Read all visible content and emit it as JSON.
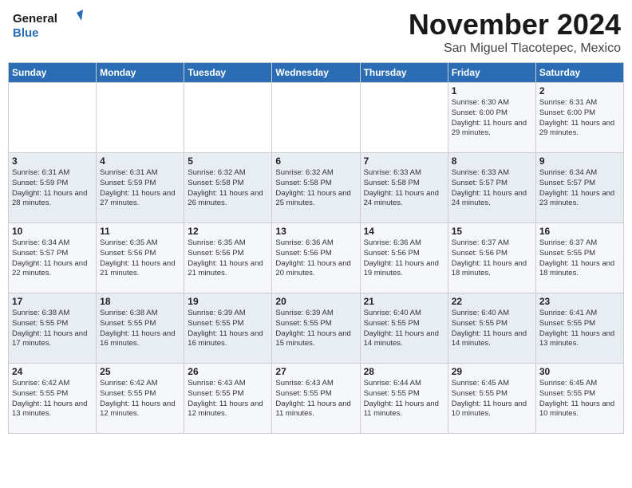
{
  "logo": {
    "line1": "General",
    "line2": "Blue"
  },
  "title": "November 2024",
  "subtitle": "San Miguel Tlacotepec, Mexico",
  "weekdays": [
    "Sunday",
    "Monday",
    "Tuesday",
    "Wednesday",
    "Thursday",
    "Friday",
    "Saturday"
  ],
  "weeks": [
    [
      {
        "day": "",
        "info": ""
      },
      {
        "day": "",
        "info": ""
      },
      {
        "day": "",
        "info": ""
      },
      {
        "day": "",
        "info": ""
      },
      {
        "day": "",
        "info": ""
      },
      {
        "day": "1",
        "info": "Sunrise: 6:30 AM\nSunset: 6:00 PM\nDaylight: 11 hours and 29 minutes."
      },
      {
        "day": "2",
        "info": "Sunrise: 6:31 AM\nSunset: 6:00 PM\nDaylight: 11 hours and 29 minutes."
      }
    ],
    [
      {
        "day": "3",
        "info": "Sunrise: 6:31 AM\nSunset: 5:59 PM\nDaylight: 11 hours and 28 minutes."
      },
      {
        "day": "4",
        "info": "Sunrise: 6:31 AM\nSunset: 5:59 PM\nDaylight: 11 hours and 27 minutes."
      },
      {
        "day": "5",
        "info": "Sunrise: 6:32 AM\nSunset: 5:58 PM\nDaylight: 11 hours and 26 minutes."
      },
      {
        "day": "6",
        "info": "Sunrise: 6:32 AM\nSunset: 5:58 PM\nDaylight: 11 hours and 25 minutes."
      },
      {
        "day": "7",
        "info": "Sunrise: 6:33 AM\nSunset: 5:58 PM\nDaylight: 11 hours and 24 minutes."
      },
      {
        "day": "8",
        "info": "Sunrise: 6:33 AM\nSunset: 5:57 PM\nDaylight: 11 hours and 24 minutes."
      },
      {
        "day": "9",
        "info": "Sunrise: 6:34 AM\nSunset: 5:57 PM\nDaylight: 11 hours and 23 minutes."
      }
    ],
    [
      {
        "day": "10",
        "info": "Sunrise: 6:34 AM\nSunset: 5:57 PM\nDaylight: 11 hours and 22 minutes."
      },
      {
        "day": "11",
        "info": "Sunrise: 6:35 AM\nSunset: 5:56 PM\nDaylight: 11 hours and 21 minutes."
      },
      {
        "day": "12",
        "info": "Sunrise: 6:35 AM\nSunset: 5:56 PM\nDaylight: 11 hours and 21 minutes."
      },
      {
        "day": "13",
        "info": "Sunrise: 6:36 AM\nSunset: 5:56 PM\nDaylight: 11 hours and 20 minutes."
      },
      {
        "day": "14",
        "info": "Sunrise: 6:36 AM\nSunset: 5:56 PM\nDaylight: 11 hours and 19 minutes."
      },
      {
        "day": "15",
        "info": "Sunrise: 6:37 AM\nSunset: 5:56 PM\nDaylight: 11 hours and 18 minutes."
      },
      {
        "day": "16",
        "info": "Sunrise: 6:37 AM\nSunset: 5:55 PM\nDaylight: 11 hours and 18 minutes."
      }
    ],
    [
      {
        "day": "17",
        "info": "Sunrise: 6:38 AM\nSunset: 5:55 PM\nDaylight: 11 hours and 17 minutes."
      },
      {
        "day": "18",
        "info": "Sunrise: 6:38 AM\nSunset: 5:55 PM\nDaylight: 11 hours and 16 minutes."
      },
      {
        "day": "19",
        "info": "Sunrise: 6:39 AM\nSunset: 5:55 PM\nDaylight: 11 hours and 16 minutes."
      },
      {
        "day": "20",
        "info": "Sunrise: 6:39 AM\nSunset: 5:55 PM\nDaylight: 11 hours and 15 minutes."
      },
      {
        "day": "21",
        "info": "Sunrise: 6:40 AM\nSunset: 5:55 PM\nDaylight: 11 hours and 14 minutes."
      },
      {
        "day": "22",
        "info": "Sunrise: 6:40 AM\nSunset: 5:55 PM\nDaylight: 11 hours and 14 minutes."
      },
      {
        "day": "23",
        "info": "Sunrise: 6:41 AM\nSunset: 5:55 PM\nDaylight: 11 hours and 13 minutes."
      }
    ],
    [
      {
        "day": "24",
        "info": "Sunrise: 6:42 AM\nSunset: 5:55 PM\nDaylight: 11 hours and 13 minutes."
      },
      {
        "day": "25",
        "info": "Sunrise: 6:42 AM\nSunset: 5:55 PM\nDaylight: 11 hours and 12 minutes."
      },
      {
        "day": "26",
        "info": "Sunrise: 6:43 AM\nSunset: 5:55 PM\nDaylight: 11 hours and 12 minutes."
      },
      {
        "day": "27",
        "info": "Sunrise: 6:43 AM\nSunset: 5:55 PM\nDaylight: 11 hours and 11 minutes."
      },
      {
        "day": "28",
        "info": "Sunrise: 6:44 AM\nSunset: 5:55 PM\nDaylight: 11 hours and 11 minutes."
      },
      {
        "day": "29",
        "info": "Sunrise: 6:45 AM\nSunset: 5:55 PM\nDaylight: 11 hours and 10 minutes."
      },
      {
        "day": "30",
        "info": "Sunrise: 6:45 AM\nSunset: 5:55 PM\nDaylight: 11 hours and 10 minutes."
      }
    ]
  ]
}
